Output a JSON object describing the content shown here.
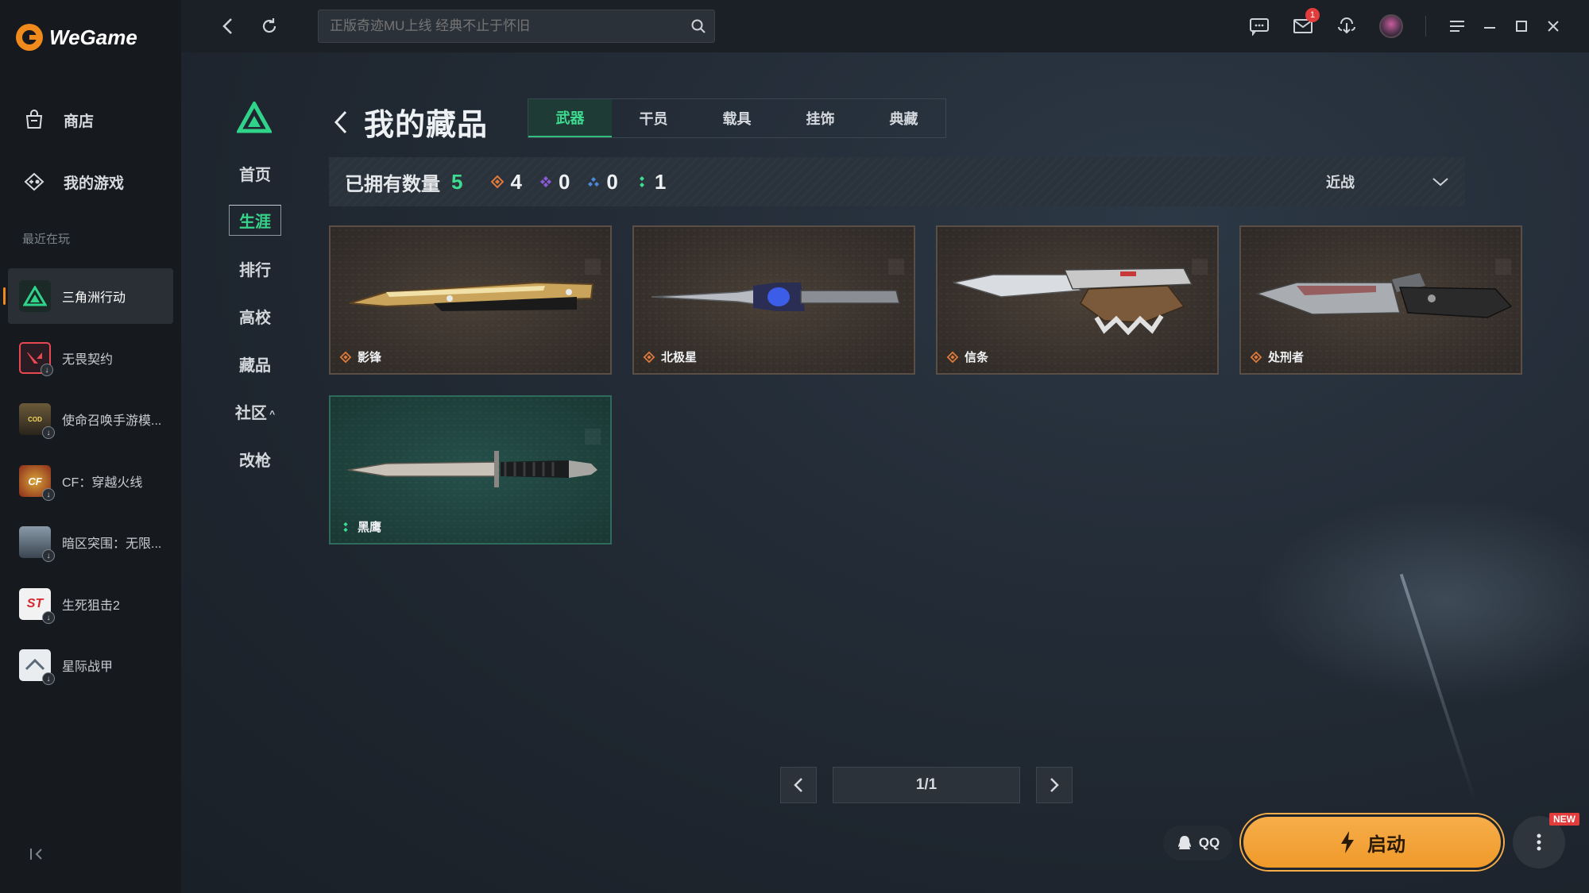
{
  "app": {
    "brand": "WeGame",
    "colors": {
      "accent": "#f08a1c",
      "green": "#3ddc91",
      "launch": "#f6ad4a"
    }
  },
  "sidebar": {
    "nav": [
      {
        "label": "商店",
        "icon": "shop-bag-icon"
      },
      {
        "label": "我的游戏",
        "icon": "gamepad-icon"
      }
    ],
    "recent_title": "最近在玩",
    "games": [
      {
        "label": "三角洲行动",
        "active": true
      },
      {
        "label": "无畏契约"
      },
      {
        "label": "使命召唤手游模..."
      },
      {
        "label": "CF：穿越火线"
      },
      {
        "label": "暗区突围：无限..."
      },
      {
        "label": "生死狙击2"
      },
      {
        "label": "星际战甲"
      }
    ]
  },
  "topbar": {
    "search_placeholder": "正版奇迹MU上线 经典不止于怀旧",
    "mail_badge": "1"
  },
  "game_nav": {
    "items": [
      "首页",
      "生涯",
      "排行",
      "高校",
      "藏品",
      "社区",
      "改枪"
    ],
    "active": "生涯"
  },
  "page": {
    "title": "我的藏品",
    "tabs": [
      "武器",
      "干员",
      "载具",
      "挂饰",
      "典藏"
    ],
    "active_tab": "武器"
  },
  "stats": {
    "owned_label": "已拥有数量",
    "owned_count": "5",
    "rarities": [
      {
        "color": "#e07a3a",
        "count": "4"
      },
      {
        "color": "#8a5ad8",
        "count": "0"
      },
      {
        "color": "#4a8ad8",
        "count": "0"
      },
      {
        "color": "#3ddc91",
        "count": "1"
      }
    ],
    "filter": "近战"
  },
  "items": [
    {
      "name": "影锋",
      "rarity": "orange"
    },
    {
      "name": "北极星",
      "rarity": "orange"
    },
    {
      "name": "信条",
      "rarity": "orange"
    },
    {
      "name": "处刑者",
      "rarity": "orange"
    },
    {
      "name": "黑鹰",
      "rarity": "green"
    }
  ],
  "pager": {
    "text": "1/1"
  },
  "footer": {
    "qq_label": "QQ",
    "launch_label": "启动",
    "new_tag": "NEW"
  }
}
